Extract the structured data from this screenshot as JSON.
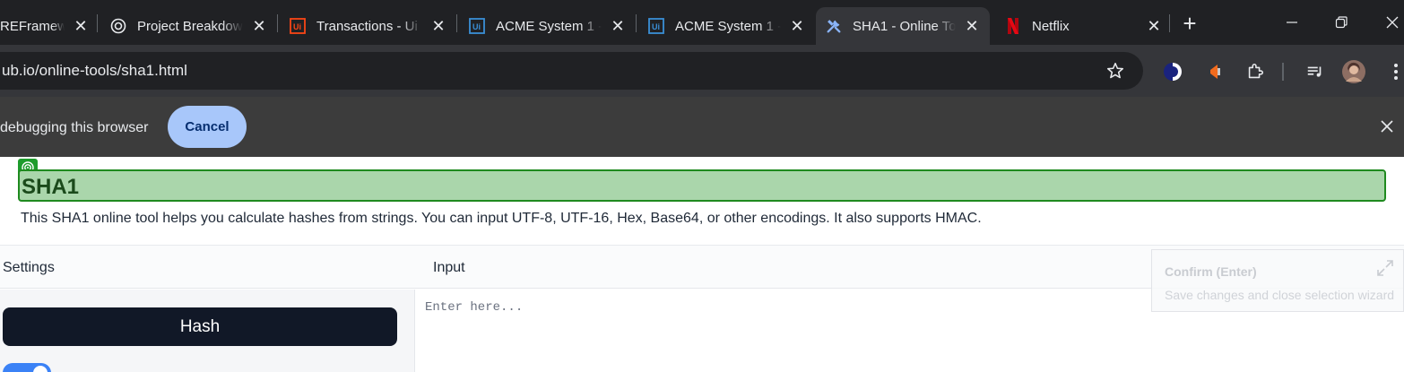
{
  "tabs": [
    {
      "title": "REFramew",
      "icon": "none-icon",
      "close": "✕"
    },
    {
      "title": "Project Breakdow",
      "icon": "openai-icon",
      "close": "✕"
    },
    {
      "title": "Transactions - Ui",
      "icon": "uipath-orange-icon",
      "close": "✕"
    },
    {
      "title": "ACME System 1 -",
      "icon": "uipath-blue-icon",
      "close": "✕"
    },
    {
      "title": "ACME System 1 -",
      "icon": "uipath-blue-icon",
      "close": "✕"
    },
    {
      "title": "SHA1 - Online To",
      "icon": "tools-icon",
      "close": "✕",
      "active": true
    },
    {
      "title": "Netflix",
      "icon": "netflix-icon",
      "close": "✕"
    }
  ],
  "address_bar": {
    "url": "ub.io/online-tools/sha1.html"
  },
  "infobar": {
    "message": "debugging this browser",
    "cancel_label": "Cancel"
  },
  "page": {
    "heading": "SHA1",
    "description": "This SHA1 online tool helps you calculate hashes from strings. You can input UTF-8, UTF-16, Hex, Base64, or other encodings. It also supports HMAC.",
    "settings_label": "Settings",
    "input_label": "Input",
    "hash_button_label": "Hash",
    "input_placeholder": "Enter here..."
  },
  "wizard": {
    "title": "Confirm (Enter)",
    "subtitle": "Save changes and close selection wizard"
  },
  "colors": {
    "tabstrip": "#202124",
    "toolbar": "#35363a",
    "highlight_fill": "#aad6ab",
    "highlight_border": "#1f8a1f",
    "hash_button": "#111827",
    "toggle_on": "#3b82f6"
  }
}
